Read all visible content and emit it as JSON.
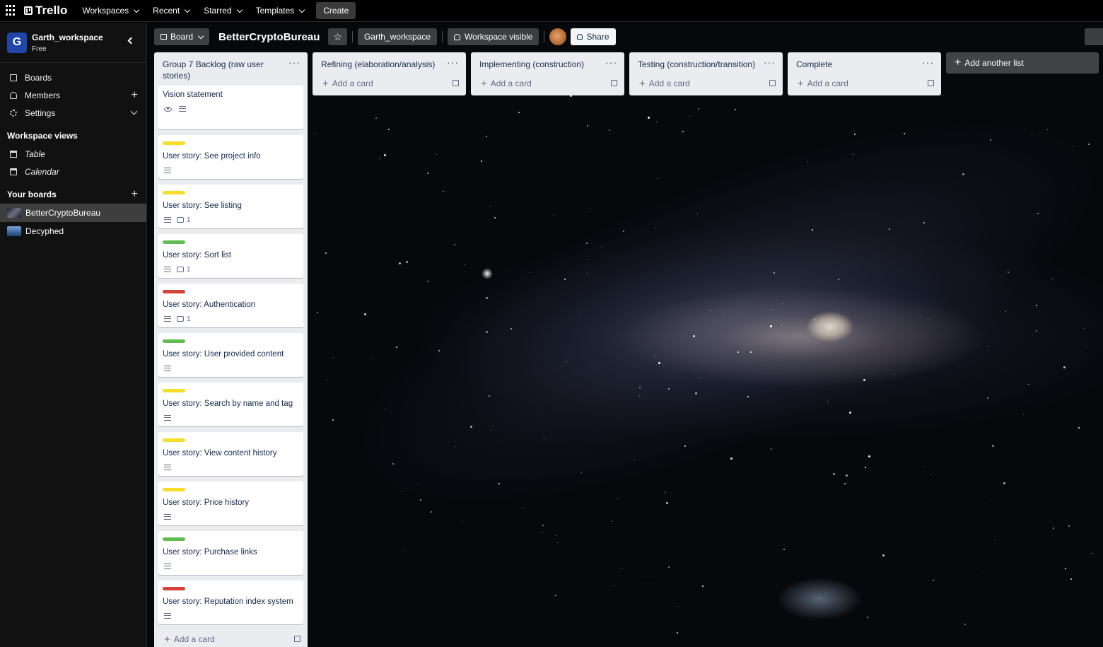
{
  "topnav": {
    "logo": "Trello",
    "menus": [
      "Workspaces",
      "Recent",
      "Starred",
      "Templates"
    ],
    "create_label": "Create"
  },
  "sidebar": {
    "workspace_initial": "G",
    "workspace_name": "Garth_workspace",
    "workspace_plan": "Free",
    "nav": [
      {
        "label": "Boards",
        "icon": "board-icon"
      },
      {
        "label": "Members",
        "icon": "person-icon"
      },
      {
        "label": "Settings",
        "icon": "gear-icon"
      }
    ],
    "workspace_views_title": "Workspace views",
    "views": [
      {
        "label": "Table",
        "icon": "table-icon"
      },
      {
        "label": "Calendar",
        "icon": "calendar-icon"
      }
    ],
    "your_boards_title": "Your boards",
    "boards": [
      "BetterCryptoBureau",
      "Decyphed"
    ]
  },
  "board": {
    "view_label": "Board",
    "title": "BetterCryptoBureau",
    "workspace_label": "Garth_workspace",
    "visibility_label": "Workspace visible",
    "share_label": "Share",
    "add_another_list": "Add another list",
    "add_card_label": "Add a card",
    "lists": [
      {
        "title": "Group 7 Backlog (raw user stories)",
        "cards": [
          {
            "title": "Vision statement",
            "label": null,
            "watch": true,
            "desc": true,
            "comments": null
          },
          {
            "title": "User story: See project info",
            "label": "#f5dd29",
            "desc": true,
            "comments": null
          },
          {
            "title": "User story: See listing",
            "label": "#f5dd29",
            "desc": true,
            "comments": "1"
          },
          {
            "title": "User story: Sort list",
            "label": "#61bd4f",
            "desc": true,
            "comments": "1"
          },
          {
            "title": "User story: Authentication",
            "label": "#d04437",
            "desc": true,
            "comments": "1"
          },
          {
            "title": "User story: User provided content",
            "label": "#61bd4f",
            "desc": true,
            "comments": null
          },
          {
            "title": "User story: Search by name and tag",
            "label": "#f5dd29",
            "desc": true,
            "comments": null
          },
          {
            "title": "User story: View content history",
            "label": "#f5dd29",
            "desc": true,
            "comments": null
          },
          {
            "title": "User story: Price history",
            "label": "#f5dd29",
            "desc": true,
            "comments": null
          },
          {
            "title": "User story: Purchase links",
            "label": "#61bd4f",
            "desc": true,
            "comments": null
          },
          {
            "title": "User story: Reputation index system",
            "label": "#d04437",
            "desc": true,
            "comments": null
          }
        ]
      },
      {
        "title": "Refining (elaboration/analysis)",
        "cards": []
      },
      {
        "title": "Implementing (construction)",
        "cards": []
      },
      {
        "title": "Testing (construction/transition)",
        "cards": []
      },
      {
        "title": "Complete",
        "cards": []
      }
    ]
  },
  "colors": {
    "label_yellow": "#f5dd29",
    "label_green": "#61bd4f",
    "label_red": "#d04437",
    "workspace_avatar": "#1f46a8"
  }
}
